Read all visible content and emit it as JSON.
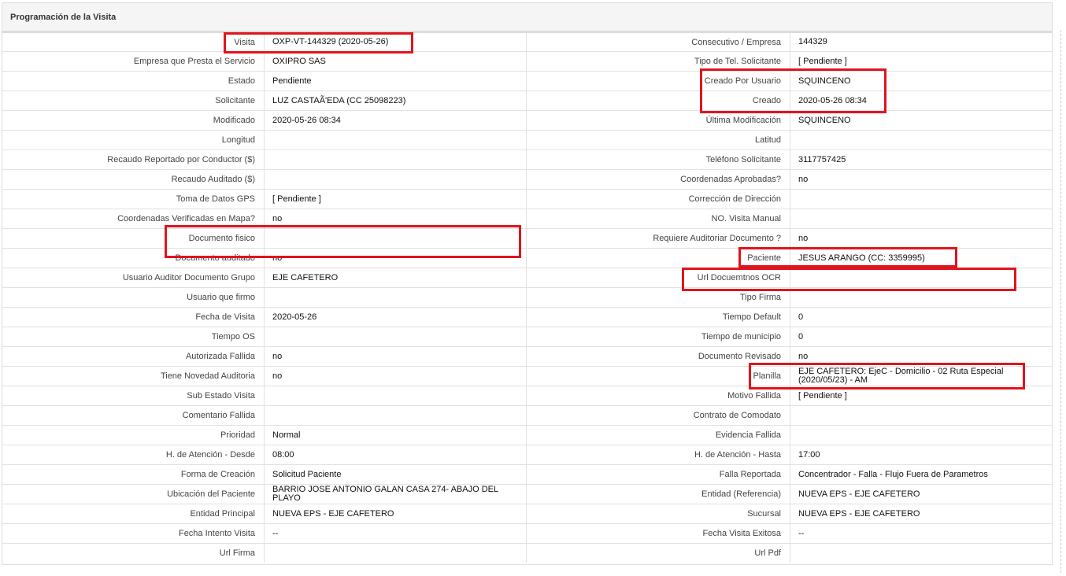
{
  "panel": {
    "title": "Programación de la Visita"
  },
  "rows": [
    [
      "Visita",
      "OXP-VT-144329 (2020-05-26)",
      "Consecutivo / Empresa",
      "144329"
    ],
    [
      "Empresa que Presta el Servicio",
      "OXIPRO SAS",
      "Tipo de Tel. Solicitante",
      "[ Pendiente ]"
    ],
    [
      "Estado",
      "Pendiente",
      "Creado Por Usuario",
      "SQUINCENO"
    ],
    [
      "Solicitante",
      "LUZ CASTAÃ'EDA (CC 25098223)",
      "Creado",
      "2020-05-26 08:34"
    ],
    [
      "Modificado",
      "2020-05-26 08:34",
      "Última Modificación",
      " SQUINCENO"
    ],
    [
      "Longitud",
      "",
      "Latitud",
      ""
    ],
    [
      "Recaudo Reportado por Conductor ($)",
      "",
      "Teléfono Solicitante",
      "3117757425"
    ],
    [
      "Recaudo Auditado ($)",
      "",
      "Coordenadas Aprobadas?",
      " no"
    ],
    [
      "Toma de Datos GPS",
      "[ Pendiente ]",
      "Corrección de Dirección",
      ""
    ],
    [
      "Coordenadas Verificadas en Mapa?",
      " no",
      "NO. Visita Manual",
      ""
    ],
    [
      "Documento fisico",
      "",
      "Requiere Auditoriar Documento ?",
      " no"
    ],
    [
      "Documento auditado",
      " no",
      "Paciente",
      "JESUS ARANGO (CC: 3359995)"
    ],
    [
      "Usuario Auditor Documento Grupo",
      "EJE CAFETERO",
      "Url Docuemtnos OCR",
      ""
    ],
    [
      "Usuario que firmo",
      "",
      "Tipo Firma",
      ""
    ],
    [
      "Fecha de Visita",
      " 2020-05-26",
      "Tiempo Default",
      "0"
    ],
    [
      "Tiempo OS",
      "",
      "Tiempo de municipio",
      "0"
    ],
    [
      "Autorizada Fallida",
      " no",
      "Documento Revisado",
      " no"
    ],
    [
      "Tiene Novedad Auditoria",
      " no",
      "Planilla",
      "EJE CAFETERO: EjeC - Domicilio - 02 Ruta Especial (2020/05/23) - AM"
    ],
    [
      "Sub Estado Visita",
      "",
      "Motivo Fallida",
      "[ Pendiente ]"
    ],
    [
      "Comentario Fallida",
      "",
      "Contrato de Comodato",
      ""
    ],
    [
      "Prioridad",
      "Normal",
      "Evidencia Fallida",
      ""
    ],
    [
      "H. de Atención - Desde",
      "08:00",
      "H. de Atención - Hasta",
      "17:00"
    ],
    [
      "Forma de Creación",
      "Solicitud Paciente",
      "Falla Reportada",
      "Concentrador - Falla - Flujo Fuera de Parametros"
    ],
    [
      "Ubicación del Paciente",
      "BARRIO JOSE ANTONIO GALAN CASA 274- ABAJO DEL PLAYO",
      "Entidad (Referencia)",
      "NUEVA EPS - EJE CAFETERO"
    ],
    [
      "Entidad Principal",
      "NUEVA EPS - EJE CAFETERO",
      "Sucursal",
      "NUEVA EPS - EJE CAFETERO"
    ],
    [
      "Fecha Intento Visita",
      " --",
      "Fecha Visita Exitosa",
      " --"
    ],
    [
      "Url Firma",
      "",
      "Url Pdf",
      ""
    ]
  ],
  "highlight_color": "#e0141e"
}
